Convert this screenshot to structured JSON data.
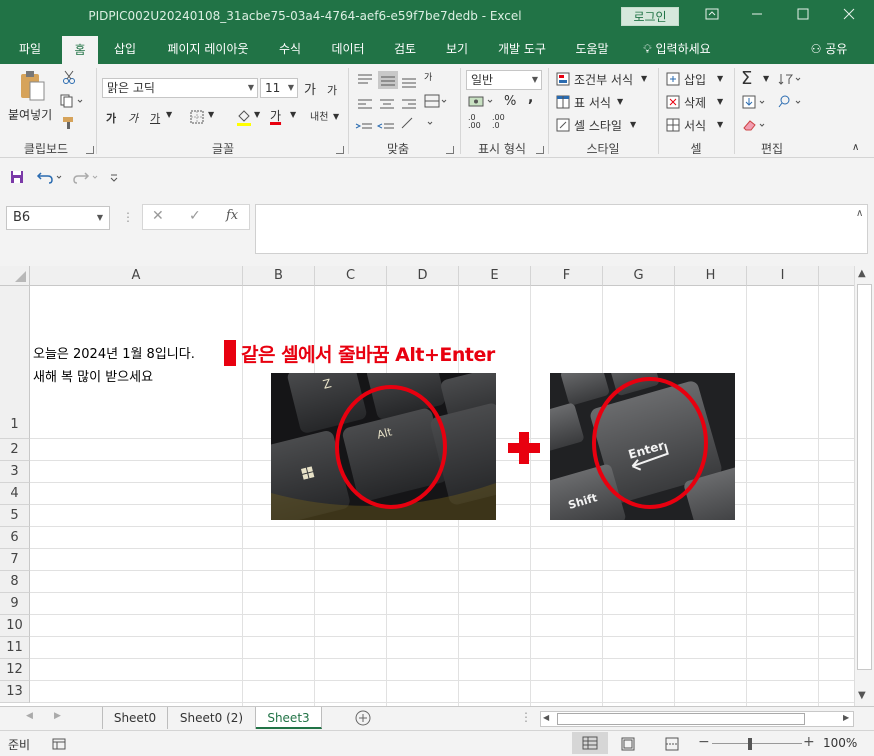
{
  "window": {
    "title": "PIDPIC002U20240108_31acbe75-03a4-4764-aef6-e59f7be7dedb  -  Excel",
    "login_label": "로그인"
  },
  "tabs": [
    "파일",
    "홈",
    "삽입",
    "페이지 레이아웃",
    "수식",
    "데이터",
    "검토",
    "보기",
    "개발 도구",
    "도움말"
  ],
  "tell_me": "입력하세요",
  "share": "공유",
  "ribbon": {
    "clipboard": {
      "paste": "붙여넣기",
      "label": "클립보드"
    },
    "font": {
      "name": "맑은 고딕",
      "size": "11",
      "grow": "가",
      "shrink": "가",
      "bold": "가",
      "italic": "가",
      "underline": "가",
      "color_letter": "가",
      "phonetic": "내천",
      "label": "글꼴"
    },
    "alignment": {
      "wrap": "가",
      "label": "맞춤"
    },
    "number": {
      "format": "일반",
      "percent": "%",
      "comma": ",",
      "inc_decimal": ".0 .00",
      "dec_decimal": ".00 .0",
      "label": "표시 형식"
    },
    "styles": {
      "conditional": "조건부 서식",
      "table": "표 서식",
      "cell": "셀 스타일",
      "label": "스타일"
    },
    "cells": {
      "insert": "삽입",
      "delete": "삭제",
      "format": "서식",
      "label": "셀"
    },
    "editing": {
      "label": "편집"
    }
  },
  "formula_bar": {
    "name_box": "B6",
    "cancel": "✕",
    "enter": "✓",
    "fx": "fx",
    "value": ""
  },
  "columns": [
    "A",
    "B",
    "C",
    "D",
    "E",
    "F",
    "G",
    "H",
    "I"
  ],
  "rows": [
    "1",
    "2",
    "3",
    "4",
    "5",
    "6",
    "7",
    "8",
    "9",
    "10",
    "11",
    "12",
    "13"
  ],
  "cell_a1": {
    "line1": "오늘은 2024년 1월 8입니다.",
    "line2": "새해 복 많이 받으세요"
  },
  "overlay": {
    "heading": "같은 셀에서 줄바꿈 Alt+Enter",
    "alt_key": "Alt",
    "z_key": "Z",
    "enter_key": "Enter",
    "shift_key": "Shift",
    "plus": "+"
  },
  "sheets": [
    "Sheet0",
    "Sheet0 (2)",
    "Sheet3"
  ],
  "status": {
    "ready": "준비",
    "zoom": "100%"
  },
  "colors": {
    "accent": "#217346",
    "highlight": "#e8000f"
  }
}
